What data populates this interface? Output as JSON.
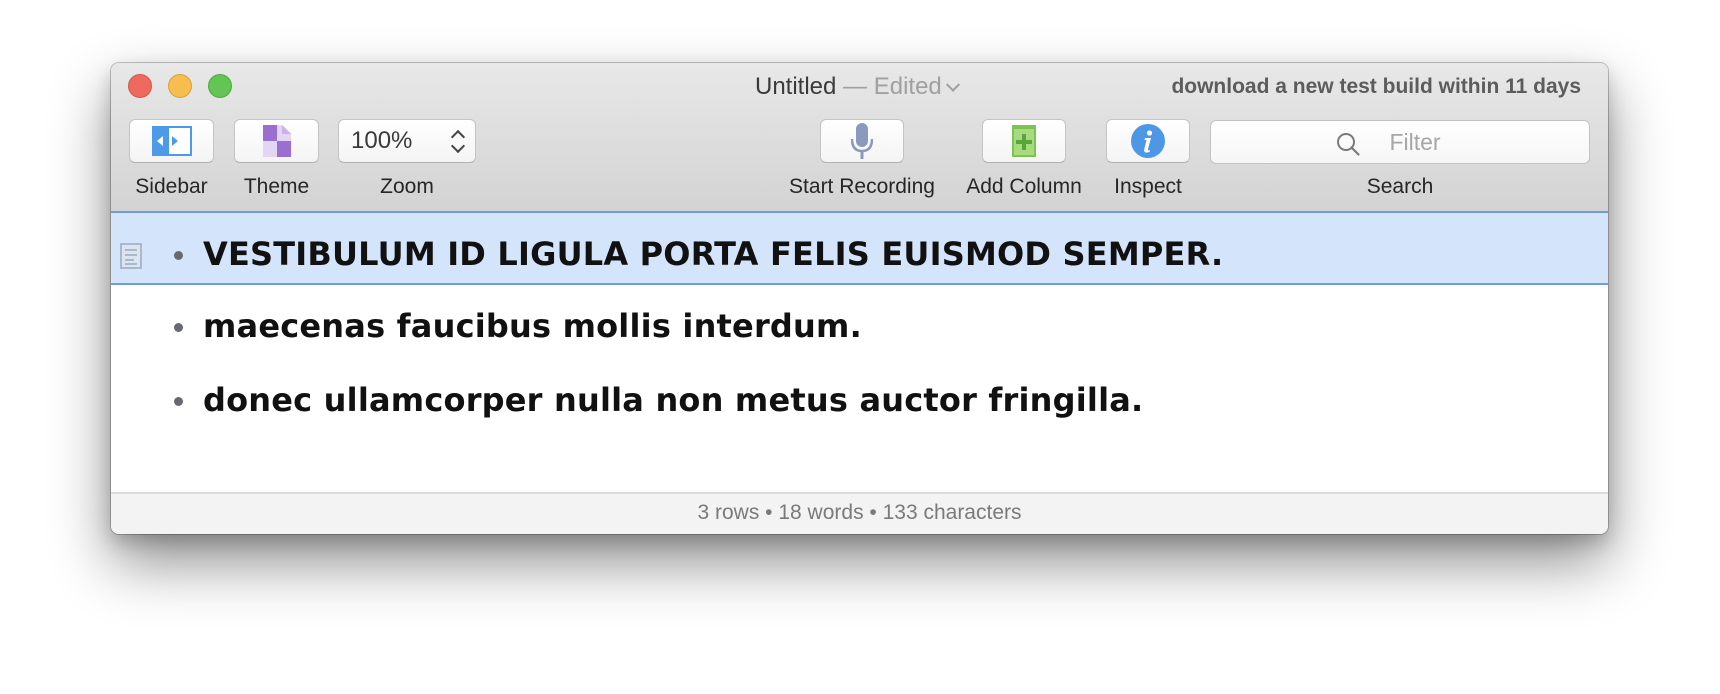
{
  "window": {
    "title": "Untitled",
    "title_separator": "—",
    "title_status": "Edited",
    "notice": "download a new test build within 11 days"
  },
  "toolbar": {
    "sidebar_label": "Sidebar",
    "theme_label": "Theme",
    "zoom_label": "Zoom",
    "zoom_value": "100%",
    "start_recording_label": "Start Recording",
    "add_column_label": "Add Column",
    "inspect_label": "Inspect",
    "search_label": "Search",
    "search_placeholder": "Filter",
    "search_value": ""
  },
  "icons": {
    "sidebar": "sidebar-toggle-icon",
    "theme": "theme-icon",
    "zoom_stepper": "up-down-chevron-icon",
    "start_recording": "microphone-icon",
    "add_column": "add-column-icon",
    "inspect": "info-icon",
    "search": "magnifier-icon",
    "row": "document-note-icon"
  },
  "colors": {
    "selection_bg": "#d3e4fb",
    "selection_border": "#6d9ddd",
    "sidebar_icon": "#4d9ae8",
    "theme_icon": "#9b6fd0",
    "mic_icon": "#8a99bd",
    "add_column_icon": "#7cc352",
    "info_icon": "#4d97e6"
  },
  "rows": [
    {
      "text": "VESTIBULUM ID LIGULA PORTA FELIS EUISMOD SEMPER.",
      "selected": true
    },
    {
      "text": "maecenas faucibus mollis interdum.",
      "selected": false
    },
    {
      "text": "donec ullamcorper nulla non metus auctor fringilla.",
      "selected": false
    }
  ],
  "footer": {
    "stats": "3 rows • 18 words • 133 characters"
  }
}
